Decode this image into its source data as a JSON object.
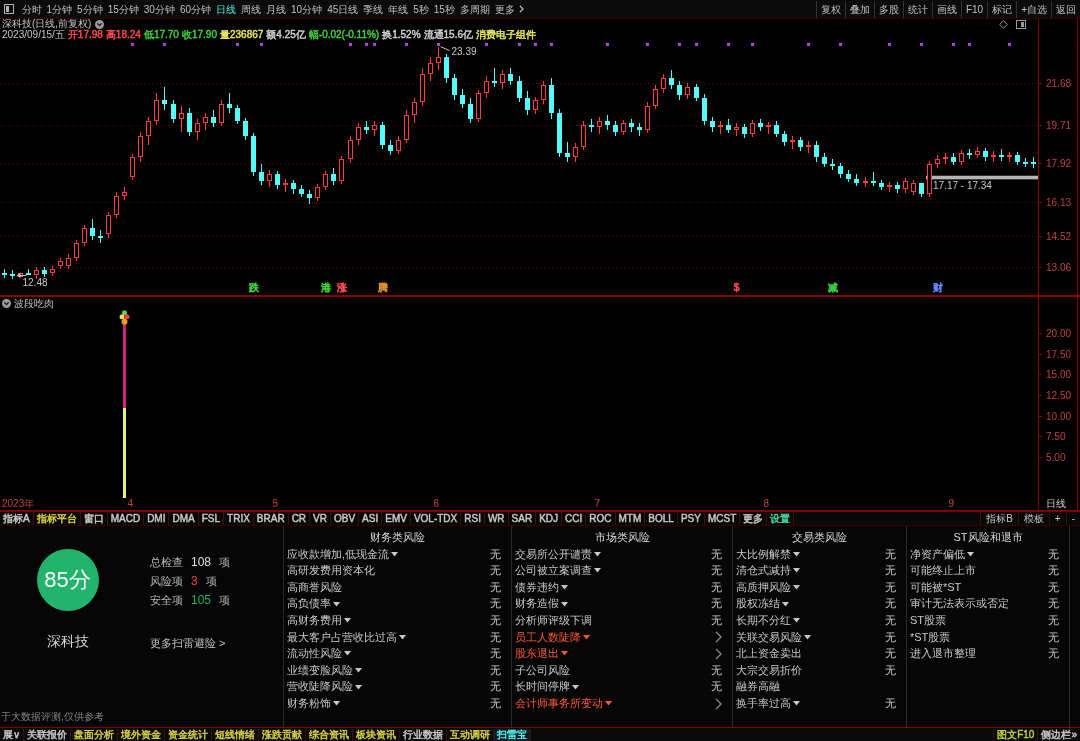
{
  "toolbar": {
    "periods": [
      {
        "label": "分时",
        "selected": false
      },
      {
        "label": "1分钟",
        "selected": false
      },
      {
        "label": "5分钟",
        "selected": false
      },
      {
        "label": "15分钟",
        "selected": false
      },
      {
        "label": "30分钟",
        "selected": false
      },
      {
        "label": "60分钟",
        "selected": false
      },
      {
        "label": "日线",
        "selected": true
      },
      {
        "label": "周线",
        "selected": false
      },
      {
        "label": "月线",
        "selected": false
      },
      {
        "label": "10分钟",
        "selected": false
      },
      {
        "label": "45日线",
        "selected": false
      },
      {
        "label": "季线",
        "selected": false
      },
      {
        "label": "年线",
        "selected": false
      },
      {
        "label": "5秒",
        "selected": false
      },
      {
        "label": "15秒",
        "selected": false
      },
      {
        "label": "多周期",
        "selected": false
      }
    ],
    "more": "更多",
    "tools": [
      "复权",
      "叠加",
      "多股",
      "统计",
      "画线",
      "F10",
      "标记",
      "+自选",
      "返回"
    ]
  },
  "quote": {
    "title": "深科技(日线,前复权)",
    "date": "2023/09/15/五",
    "fields": [
      {
        "text": "开17.98",
        "color": "#ff4a4a"
      },
      {
        "text": "高18.24",
        "color": "#ff4a4a"
      },
      {
        "text": "低17.70",
        "color": "#3cd23c"
      },
      {
        "text": "收17.90",
        "color": "#3cd23c"
      },
      {
        "text": "量236867",
        "color": "#e6e65a"
      },
      {
        "text": "额4.25亿",
        "color": "#d0d0d0"
      },
      {
        "text": "幅-0.02(-0.11%)",
        "color": "#3cd23c"
      },
      {
        "text": "换1.52%",
        "color": "#d0d0d0"
      },
      {
        "text": "流通15.6亿",
        "color": "#d0d0d0"
      },
      {
        "text": "消费电子组件",
        "color": "#e6e65a"
      }
    ]
  },
  "chart": {
    "indicator_name": "波段吃肉",
    "period_label": "日线",
    "event_markers": [
      {
        "label": "跌",
        "color": "#3cd23c"
      },
      {
        "label": "港",
        "color": "#3cd23c"
      },
      {
        "label": "涨",
        "color": "#ff4a4a"
      },
      {
        "label": "腾",
        "color": "#e09030"
      },
      {
        "label": "$",
        "color": "#ff4a4a"
      },
      {
        "label": "减",
        "color": "#3cd23c"
      },
      {
        "label": "财",
        "color": "#5a8cff"
      }
    ],
    "chart_data": [
      {
        "type": "candlestick",
        "ylim": [
          11.75,
          23.7
        ],
        "yticks": [
          13.06,
          14.52,
          16.13,
          17.92,
          19.71,
          21.68
        ],
        "tick_labels": "y",
        "grid": true,
        "ohlc": [
          [
            12.8,
            12.95,
            12.55,
            12.7
          ],
          [
            12.75,
            12.9,
            12.48,
            12.63
          ],
          [
            12.6,
            12.8,
            12.6,
            12.8
          ],
          [
            12.8,
            12.95,
            12.7,
            12.7
          ],
          [
            12.7,
            13.05,
            12.52,
            12.9
          ],
          [
            12.9,
            13.05,
            12.6,
            12.75
          ],
          [
            12.8,
            13.1,
            12.65,
            12.95
          ],
          [
            13.1,
            13.5,
            12.95,
            13.35
          ],
          [
            13.1,
            13.65,
            12.95,
            13.5
          ],
          [
            13.5,
            14.35,
            13.35,
            14.2
          ],
          [
            14.2,
            15.05,
            14.05,
            14.9
          ],
          [
            14.9,
            15.3,
            14.35,
            14.5
          ],
          [
            14.5,
            14.8,
            14.2,
            14.4
          ],
          [
            14.6,
            15.65,
            14.4,
            15.5
          ],
          [
            15.5,
            16.6,
            15.35,
            16.4
          ],
          [
            16.4,
            16.8,
            16.2,
            16.6
          ],
          [
            17.3,
            18.35,
            17.15,
            18.2
          ],
          [
            18.2,
            19.4,
            18.0,
            19.2
          ],
          [
            19.2,
            20.1,
            18.8,
            19.9
          ],
          [
            19.9,
            21.2,
            19.7,
            20.9
          ],
          [
            20.9,
            21.5,
            20.4,
            20.7
          ],
          [
            20.7,
            20.9,
            19.8,
            20.0
          ],
          [
            20.0,
            20.6,
            19.4,
            20.3
          ],
          [
            20.3,
            20.5,
            19.2,
            19.4
          ],
          [
            19.4,
            20.0,
            19.0,
            19.8
          ],
          [
            19.8,
            20.3,
            19.5,
            20.1
          ],
          [
            20.1,
            20.4,
            19.6,
            19.8
          ],
          [
            19.8,
            20.9,
            19.65,
            20.7
          ],
          [
            20.7,
            21.2,
            20.3,
            20.5
          ],
          [
            20.5,
            20.65,
            19.75,
            19.9
          ],
          [
            19.9,
            20.05,
            19.0,
            19.2
          ],
          [
            19.2,
            19.35,
            17.35,
            17.5
          ],
          [
            17.5,
            17.9,
            16.9,
            17.1
          ],
          [
            17.1,
            17.6,
            16.8,
            17.4
          ],
          [
            17.4,
            17.55,
            16.7,
            16.9
          ],
          [
            16.9,
            17.2,
            16.6,
            17.0
          ],
          [
            17.0,
            17.15,
            16.5,
            16.7
          ],
          [
            16.7,
            16.9,
            16.35,
            16.5
          ],
          [
            16.5,
            16.65,
            16.0,
            16.3
          ],
          [
            16.3,
            16.95,
            16.15,
            16.8
          ],
          [
            16.8,
            17.55,
            16.65,
            17.4
          ],
          [
            17.4,
            17.7,
            16.9,
            17.1
          ],
          [
            17.1,
            18.25,
            16.95,
            18.1
          ],
          [
            18.1,
            19.2,
            17.95,
            19.0
          ],
          [
            19.0,
            19.8,
            18.8,
            19.6
          ],
          [
            19.6,
            19.9,
            19.3,
            19.5
          ],
          [
            19.5,
            19.9,
            19.2,
            19.7
          ],
          [
            19.7,
            19.85,
            18.6,
            18.8
          ],
          [
            18.8,
            19.0,
            18.3,
            18.5
          ],
          [
            18.5,
            19.2,
            18.35,
            19.0
          ],
          [
            19.0,
            20.4,
            18.85,
            20.2
          ],
          [
            20.2,
            21.0,
            19.8,
            20.8
          ],
          [
            20.8,
            22.4,
            20.6,
            22.1
          ],
          [
            22.1,
            22.9,
            21.8,
            22.6
          ],
          [
            22.6,
            23.39,
            22.3,
            22.9
          ],
          [
            22.9,
            23.05,
            21.7,
            21.9
          ],
          [
            21.9,
            22.1,
            20.9,
            21.1
          ],
          [
            21.1,
            21.4,
            20.5,
            20.7
          ],
          [
            20.7,
            21.0,
            19.8,
            20.0
          ],
          [
            20.0,
            21.35,
            19.85,
            21.2
          ],
          [
            21.2,
            22.0,
            21.0,
            21.8
          ],
          [
            21.8,
            22.4,
            21.5,
            21.7
          ],
          [
            21.7,
            22.3,
            21.4,
            22.1
          ],
          [
            22.1,
            22.4,
            21.6,
            21.8
          ],
          [
            21.8,
            22.0,
            20.8,
            21.0
          ],
          [
            21.0,
            21.3,
            20.2,
            20.4
          ],
          [
            20.4,
            21.05,
            20.25,
            20.9
          ],
          [
            20.9,
            21.8,
            20.7,
            21.6
          ],
          [
            21.6,
            21.9,
            20.0,
            20.3
          ],
          [
            20.3,
            20.45,
            18.2,
            18.4
          ],
          [
            18.4,
            18.9,
            18.0,
            18.2
          ],
          [
            18.2,
            18.85,
            18.0,
            18.7
          ],
          [
            18.7,
            19.9,
            18.55,
            19.7
          ],
          [
            19.7,
            20.0,
            19.4,
            19.6
          ],
          [
            19.6,
            20.1,
            19.3,
            19.9
          ],
          [
            19.9,
            20.2,
            19.5,
            19.7
          ],
          [
            19.7,
            19.9,
            19.2,
            19.4
          ],
          [
            19.4,
            19.95,
            19.25,
            19.8
          ],
          [
            19.8,
            20.0,
            19.4,
            19.6
          ],
          [
            19.6,
            19.8,
            19.2,
            19.5
          ],
          [
            19.5,
            20.8,
            19.35,
            20.6
          ],
          [
            20.6,
            21.6,
            20.45,
            21.4
          ],
          [
            21.4,
            22.1,
            21.2,
            21.9
          ],
          [
            21.9,
            22.3,
            21.4,
            21.6
          ],
          [
            21.6,
            21.8,
            20.9,
            21.1
          ],
          [
            21.1,
            21.7,
            20.95,
            21.5
          ],
          [
            21.5,
            21.65,
            20.85,
            21.0
          ],
          [
            21.0,
            21.15,
            19.7,
            19.9
          ],
          [
            19.9,
            20.1,
            19.4,
            19.6
          ],
          [
            19.6,
            19.9,
            19.3,
            19.7
          ],
          [
            19.7,
            20.0,
            19.35,
            19.5
          ],
          [
            19.5,
            19.8,
            19.2,
            19.6
          ],
          [
            19.6,
            19.75,
            19.1,
            19.3
          ],
          [
            19.3,
            19.95,
            19.15,
            19.8
          ],
          [
            19.8,
            20.0,
            19.45,
            19.6
          ],
          [
            19.6,
            19.85,
            19.3,
            19.7
          ],
          [
            19.7,
            19.9,
            19.15,
            19.3
          ],
          [
            19.3,
            19.45,
            18.75,
            18.9
          ],
          [
            18.9,
            19.2,
            18.6,
            19.0
          ],
          [
            19.0,
            19.15,
            18.5,
            18.7
          ],
          [
            18.7,
            18.95,
            18.4,
            18.8
          ],
          [
            18.8,
            18.95,
            18.0,
            18.2
          ],
          [
            18.2,
            18.4,
            17.75,
            17.9
          ],
          [
            17.9,
            18.1,
            17.6,
            17.8
          ],
          [
            17.8,
            17.95,
            17.25,
            17.4
          ],
          [
            17.4,
            17.6,
            17.05,
            17.2
          ],
          [
            17.2,
            17.4,
            16.85,
            17.0
          ],
          [
            17.0,
            17.3,
            16.8,
            17.1
          ],
          [
            17.1,
            17.5,
            16.85,
            17.0
          ],
          [
            17.0,
            17.15,
            16.65,
            16.8
          ],
          [
            16.8,
            17.05,
            16.6,
            16.9
          ],
          [
            16.9,
            17.05,
            16.55,
            16.7
          ],
          [
            16.7,
            17.25,
            16.55,
            17.1
          ],
          [
            16.6,
            17.15,
            16.45,
            17.0
          ],
          [
            17.0,
            17.0,
            16.35,
            16.5
          ],
          [
            16.5,
            18.05,
            16.35,
            17.9
          ],
          [
            17.9,
            18.3,
            17.7,
            18.1
          ],
          [
            18.1,
            18.4,
            17.9,
            18.2
          ],
          [
            18.2,
            18.4,
            17.85,
            18.0
          ],
          [
            18.0,
            18.55,
            17.85,
            18.4
          ],
          [
            18.4,
            18.6,
            18.1,
            18.3
          ],
          [
            18.3,
            18.7,
            18.15,
            18.5
          ],
          [
            18.5,
            18.65,
            18.05,
            18.2
          ],
          [
            18.2,
            18.5,
            18.0,
            18.3
          ],
          [
            18.3,
            18.6,
            18.05,
            18.2
          ],
          [
            18.2,
            18.45,
            18.0,
            18.3
          ],
          [
            18.3,
            18.45,
            17.85,
            18.0
          ],
          [
            18.0,
            18.15,
            17.75,
            17.9
          ],
          [
            17.98,
            18.24,
            17.7,
            17.9
          ]
        ],
        "series": [
          {
            "type": "scatter",
            "color": "#b040e0",
            "values": [
              null,
              null,
              null,
              null,
              null,
              null,
              null,
              null,
              null,
              null,
              null,
              null,
              null,
              null,
              null,
              null,
              23.5,
              null,
              null,
              null,
              23.5,
              null,
              null,
              null,
              null,
              null,
              null,
              null,
              null,
              23.5,
              null,
              null,
              23.5,
              null,
              null,
              null,
              null,
              null,
              null,
              null,
              null,
              null,
              null,
              23.5,
              null,
              23.5,
              23.5,
              null,
              null,
              null,
              23.5,
              null,
              null,
              null,
              23.5,
              null,
              null,
              null,
              null,
              null,
              23.5,
              null,
              null,
              null,
              23.5,
              null,
              23.5,
              null,
              23.5,
              null,
              null,
              null,
              null,
              null,
              null,
              23.5,
              null,
              null,
              null,
              null,
              23.5,
              null,
              null,
              null,
              23.5,
              null,
              23.5,
              null,
              null,
              null,
              23.5,
              null,
              null,
              23.5,
              null,
              null,
              null,
              null,
              null,
              null,
              23.5,
              null,
              null,
              null,
              23.5,
              null,
              null,
              null,
              null,
              null,
              23.5,
              null,
              null,
              null,
              23.5,
              null,
              null,
              null,
              23.5,
              null,
              23.5,
              null,
              null,
              null,
              null,
              23.5,
              null,
              null,
              null
            ]
          }
        ],
        "annotations": [
          "23.39",
          "12.48"
        ],
        "bands": [
          {
            "axis": "y",
            "from": 17.17,
            "to": 17.34,
            "label": "17.17 - 17.34",
            "color": "#b4b4b4"
          }
        ]
      },
      {
        "type": "bar",
        "stacked": true,
        "ylim": [
          0,
          24.5
        ],
        "yticks": [
          {
            "value": 5,
            "label": "5.00"
          },
          {
            "value": 7.5,
            "label": "7.50"
          },
          {
            "value": 10,
            "label": "10.00"
          },
          {
            "value": 12.5,
            "label": "12.50"
          },
          {
            "value": 15,
            "label": "15.00"
          },
          {
            "value": 17.5,
            "label": "17.50"
          },
          {
            "value": 20,
            "label": "20.00"
          }
        ],
        "categories": [
          "2023年",
          null,
          null,
          null,
          null,
          null,
          null,
          null,
          null,
          null,
          null,
          null,
          null,
          null,
          null,
          null,
          "4",
          null,
          null,
          null,
          null,
          null,
          null,
          null,
          null,
          null,
          null,
          null,
          null,
          null,
          null,
          null,
          null,
          null,
          "5",
          null,
          null,
          null,
          null,
          null,
          null,
          null,
          null,
          null,
          null,
          null,
          null,
          null,
          null,
          null,
          null,
          null,
          null,
          null,
          "6",
          null,
          null,
          null,
          null,
          null,
          null,
          null,
          null,
          null,
          null,
          null,
          null,
          null,
          null,
          null,
          null,
          null,
          null,
          null,
          "7",
          null,
          null,
          null,
          null,
          null,
          null,
          null,
          null,
          null,
          null,
          null,
          null,
          null,
          null,
          null,
          null,
          null,
          null,
          null,
          null,
          "8",
          null,
          null,
          null,
          null,
          null,
          null,
          null,
          null,
          null,
          null,
          null,
          null,
          null,
          null,
          null,
          null,
          null,
          null,
          null,
          null,
          null,
          null,
          "9",
          null,
          null,
          null,
          null,
          null,
          null,
          null,
          null,
          null,
          null
        ],
        "series": [
          {
            "color": "#f0f064",
            "values": [
              null,
              null,
              null,
              null,
              null,
              null,
              null,
              null,
              null,
              null,
              null,
              null,
              null,
              null,
              null,
              10.9,
              null,
              null,
              null,
              null,
              null,
              null,
              null,
              null,
              null,
              null,
              null,
              null,
              null,
              null,
              null,
              null,
              null,
              null,
              null,
              null,
              null,
              null,
              null,
              null,
              null,
              null,
              null,
              null,
              null,
              null,
              null,
              null,
              null,
              null,
              null,
              null,
              null,
              null,
              null,
              null,
              null,
              null,
              null,
              null,
              null,
              null,
              null,
              null,
              null,
              null,
              null,
              null,
              null,
              null,
              null,
              null,
              null,
              null,
              null,
              null,
              null,
              null,
              null,
              null,
              null,
              null,
              null,
              null,
              null,
              null,
              null,
              null,
              null,
              null,
              null,
              null,
              null,
              null,
              null,
              null,
              null,
              null,
              null,
              null,
              null,
              null,
              null,
              null,
              null,
              null,
              null,
              null,
              null,
              null,
              null,
              null,
              null,
              null,
              null,
              null,
              null,
              null,
              null,
              null,
              null,
              null,
              null,
              null,
              null,
              null,
              null,
              null,
              null
            ]
          },
          {
            "color": "#d81e7a",
            "values": [
              null,
              null,
              null,
              null,
              null,
              null,
              null,
              null,
              null,
              null,
              null,
              null,
              null,
              null,
              null,
              10.9,
              null,
              null,
              null,
              null,
              null,
              null,
              null,
              null,
              null,
              null,
              null,
              null,
              null,
              null,
              null,
              null,
              null,
              null,
              null,
              null,
              null,
              null,
              null,
              null,
              null,
              null,
              null,
              null,
              null,
              null,
              null,
              null,
              null,
              null,
              null,
              null,
              null,
              null,
              null,
              null,
              null,
              null,
              null,
              null,
              null,
              null,
              null,
              null,
              null,
              null,
              null,
              null,
              null,
              null,
              null,
              null,
              null,
              null,
              null,
              null,
              null,
              null,
              null,
              null,
              null,
              null,
              null,
              null,
              null,
              null,
              null,
              null,
              null,
              null,
              null,
              null,
              null,
              null,
              null,
              null,
              null,
              null,
              null,
              null,
              null,
              null,
              null,
              null,
              null,
              null,
              null,
              null,
              null,
              null,
              null,
              null,
              null,
              null,
              null,
              null,
              null,
              null,
              null,
              null,
              null,
              null,
              null,
              null,
              null,
              null,
              null,
              null,
              null
            ]
          }
        ]
      }
    ]
  },
  "indicator_tabs": {
    "left": [
      {
        "label": "指标A",
        "color": "#c8c8c8"
      },
      {
        "label": "指标平台",
        "color": "#d8d040"
      },
      {
        "label": "窗口",
        "color": "#c8c8c8"
      },
      {
        "label": "MACD",
        "color": "#c8c8c8"
      },
      {
        "label": "DMI",
        "color": "#c8c8c8"
      },
      {
        "label": "DMA",
        "color": "#c8c8c8"
      },
      {
        "label": "FSL",
        "color": "#c8c8c8"
      },
      {
        "label": "TRIX",
        "color": "#c8c8c8"
      },
      {
        "label": "BRAR",
        "color": "#c8c8c8"
      },
      {
        "label": "CR",
        "color": "#c8c8c8"
      },
      {
        "label": "VR",
        "color": "#c8c8c8"
      },
      {
        "label": "OBV",
        "color": "#c8c8c8"
      },
      {
        "label": "ASI",
        "color": "#c8c8c8"
      },
      {
        "label": "EMV",
        "color": "#c8c8c8"
      },
      {
        "label": "VOL-TDX",
        "color": "#c8c8c8"
      },
      {
        "label": "RSI",
        "color": "#c8c8c8"
      },
      {
        "label": "WR",
        "color": "#c8c8c8"
      },
      {
        "label": "SAR",
        "color": "#c8c8c8"
      },
      {
        "label": "KDJ",
        "color": "#c8c8c8"
      },
      {
        "label": "CCI",
        "color": "#c8c8c8"
      },
      {
        "label": "ROC",
        "color": "#c8c8c8"
      },
      {
        "label": "MTM",
        "color": "#c8c8c8"
      },
      {
        "label": "BOLL",
        "color": "#c8c8c8"
      },
      {
        "label": "PSY",
        "color": "#c8c8c8"
      },
      {
        "label": "MCST",
        "color": "#c8c8c8"
      },
      {
        "label": "更多",
        "color": "#c8c8c8"
      },
      {
        "label": "设置",
        "color": "#40d8a0"
      }
    ],
    "right": [
      "指标B",
      "模板",
      "+",
      "-"
    ]
  },
  "risk_scan": {
    "score": "85分",
    "stock": "深科技",
    "stats": [
      {
        "kind": "total",
        "label": "总检查",
        "value": "108",
        "unit": "项"
      },
      {
        "kind": "risk",
        "label": "风险项",
        "value": "3",
        "unit": "项"
      },
      {
        "kind": "safe",
        "label": "安全项",
        "value": "105",
        "unit": "项"
      }
    ],
    "more_link": "更多扫雷避险 >",
    "disclaimer": "于大数据评测,仅供参考",
    "columns": [
      {
        "title": "财务类风险",
        "items": [
          {
            "name": "应收款增加,低现金流",
            "expandable": true,
            "risk": false,
            "status": "无"
          },
          {
            "name": "高研发费用资本化",
            "expandable": false,
            "risk": false,
            "status": "无"
          },
          {
            "name": "高商誉风险",
            "expandable": false,
            "risk": false,
            "status": "无"
          },
          {
            "name": "高负债率",
            "expandable": true,
            "risk": false,
            "status": "无"
          },
          {
            "name": "高财务费用",
            "expandable": true,
            "risk": false,
            "status": "无"
          },
          {
            "name": "最大客户占营收比过高",
            "expandable": true,
            "risk": false,
            "status": "无"
          },
          {
            "name": "流动性风险",
            "expandable": true,
            "risk": false,
            "status": "无"
          },
          {
            "name": "业绩变脸风险",
            "expandable": true,
            "risk": false,
            "status": "无"
          },
          {
            "name": "营收陡降风险",
            "expandable": true,
            "risk": false,
            "status": "无"
          },
          {
            "name": "财务粉饰",
            "expandable": true,
            "risk": false,
            "status": "无"
          }
        ]
      },
      {
        "title": "市场类风险",
        "items": [
          {
            "name": "交易所公开谴责",
            "expandable": true,
            "risk": false,
            "status": "无"
          },
          {
            "name": "公司被立案调查",
            "expandable": true,
            "risk": false,
            "status": "无"
          },
          {
            "name": "债券违约",
            "expandable": true,
            "risk": false,
            "status": "无"
          },
          {
            "name": "财务造假",
            "expandable": true,
            "risk": false,
            "status": "无"
          },
          {
            "name": "分析师评级下调",
            "expandable": false,
            "risk": false,
            "status": "无"
          },
          {
            "name": "员工人数陡降",
            "expandable": true,
            "risk": true
          },
          {
            "name": "股东退出",
            "expandable": true,
            "risk": true
          },
          {
            "name": "子公司风险",
            "expandable": false,
            "risk": false,
            "status": "无"
          },
          {
            "name": "长时间停牌",
            "expandable": true,
            "risk": false,
            "status": "无"
          },
          {
            "name": "会计师事务所变动",
            "expandable": true,
            "risk": true
          }
        ]
      },
      {
        "title": "交易类风险",
        "items": [
          {
            "name": "大比例解禁",
            "expandable": true,
            "risk": false,
            "status": "无"
          },
          {
            "name": "清仓式减持",
            "expandable": true,
            "risk": false,
            "status": "无"
          },
          {
            "name": "高质押风险",
            "expandable": true,
            "risk": false,
            "status": "无"
          },
          {
            "name": "股权冻结",
            "expandable": true,
            "risk": false,
            "status": "无"
          },
          {
            "name": "长期不分红",
            "expandable": true,
            "risk": false,
            "status": "无"
          },
          {
            "name": "关联交易风险",
            "expandable": true,
            "risk": false,
            "status": "无"
          },
          {
            "name": "北上资金卖出",
            "expandable": false,
            "risk": false,
            "status": "无"
          },
          {
            "name": "大宗交易折价",
            "expandable": false,
            "risk": false,
            "status": "无"
          },
          {
            "name": "融券高融",
            "expandable": false,
            "risk": false
          },
          {
            "name": "换手率过高",
            "expandable": true,
            "risk": false,
            "status": "无"
          }
        ]
      },
      {
        "title": "ST风险和退市",
        "items": [
          {
            "name": "净资产偏低",
            "expandable": true,
            "risk": false,
            "status": "无"
          },
          {
            "name": "可能终止上市",
            "expandable": false,
            "risk": false,
            "status": "无"
          },
          {
            "name": "可能被*ST",
            "expandable": false,
            "risk": false,
            "status": "无"
          },
          {
            "name": "审计无法表示或否定",
            "expandable": false,
            "risk": false,
            "status": "无"
          },
          {
            "name": "ST股票",
            "expandable": false,
            "risk": false,
            "status": "无"
          },
          {
            "name": "*ST股票",
            "expandable": false,
            "risk": false,
            "status": "无"
          },
          {
            "name": "进入退市整理",
            "expandable": false,
            "risk": false,
            "status": "无"
          }
        ]
      }
    ]
  },
  "bottom_tabs": {
    "items": [
      {
        "label": "展∨",
        "color": "#c8c8c8",
        "selected": false
      },
      {
        "label": "关联报价",
        "color": "#c8c8c8",
        "selected": false
      },
      {
        "label": "盘面分析",
        "color": "#d8d040",
        "selected": false
      },
      {
        "label": "境外资金",
        "color": "#d8d040",
        "selected": false
      },
      {
        "label": "资金统计",
        "color": "#d8d040",
        "selected": false
      },
      {
        "label": "短线情绪",
        "color": "#d8d040",
        "selected": false
      },
      {
        "label": "涨跌贡献",
        "color": "#d8d040",
        "selected": false
      },
      {
        "label": "综合资讯",
        "color": "#d8d040",
        "selected": false
      },
      {
        "label": "板块资讯",
        "color": "#d8d040",
        "selected": false
      },
      {
        "label": "行业数据",
        "color": "#c8c8c8",
        "selected": false
      },
      {
        "label": "互动调研",
        "color": "#d8d040",
        "selected": false
      },
      {
        "label": "扫雷宝",
        "selected": true
      }
    ],
    "right": [
      {
        "label": "图文F10",
        "color": "#b8d040"
      },
      {
        "label": "侧边栏»",
        "color": "#c8c8c8"
      }
    ]
  }
}
